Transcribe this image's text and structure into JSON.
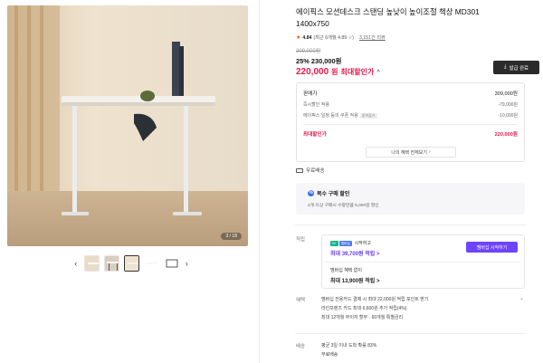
{
  "gallery": {
    "counter": "3 / 18",
    "thumbnails": [
      "thumb-1",
      "thumb-2",
      "thumb-3",
      "thumb-4",
      "thumb-5"
    ],
    "prev_icon": "‹",
    "next_icon": "›"
  },
  "product": {
    "title": "에이픽스 모션데스크 스탠딩 높낮이 높이조절 책상 MD301 1400x750",
    "rating_score": "4.84",
    "rating_detail": "(최근 6개월 4.89 ☆)",
    "reviews": "3,151건 리뷰"
  },
  "price": {
    "original": "309,000원",
    "discount_pct": "25%",
    "discount_price": "230,000원",
    "final_amount": "220,000",
    "final_unit": "원",
    "final_label": "최대할인가",
    "caret": "^",
    "coupon_button": "발급 완료"
  },
  "breakdown": {
    "sale_label": "판매가",
    "sale_value": "309,000원",
    "instant_label": "즉시할인 적용",
    "instant_value": "-79,000원",
    "coupon_label": "에이픽스 일정 등의 쿠폰 적용",
    "coupon_tag": "중복불가",
    "coupon_value": "-10,000원",
    "max_label": "최대할인가",
    "max_value": "220,000원",
    "all_benefits_button": "나의 혜택 전체보기",
    "all_benefits_caret": "›"
  },
  "shipping_badge": "무료배송",
  "multi_buy": {
    "title": "복수 구매 할인",
    "desc": "2개 이상 구매시 수량만큼 5,000원 할인"
  },
  "points": {
    "section_label": "적립",
    "membership_text": "시작하고",
    "badge1": "N+",
    "badge2": "멤버십",
    "amount1": "최대 39,700원 적립",
    "amount1_caret": ">",
    "member_button": "멤버십 시작하기",
    "no_member_text": "멤버십 혜택 없이",
    "amount2": "최대 13,900원 적립",
    "amount2_caret": ">"
  },
  "benefits": {
    "section_label": "혜택",
    "lines": [
      "멤버십 전용카드 결제 시 최대 22,000원 적립 포인트 받기",
      "라인프렌즈 카드 최대 6,600원 추가 적립(4%)",
      "최대 12개월 무이자 할부 · 60개월 특별금리"
    ],
    "caret": "⌄"
  },
  "delivery": {
    "section_label": "배송",
    "lines": [
      "평균 3일 이내 도착 확률 83%",
      "무료배송"
    ]
  }
}
